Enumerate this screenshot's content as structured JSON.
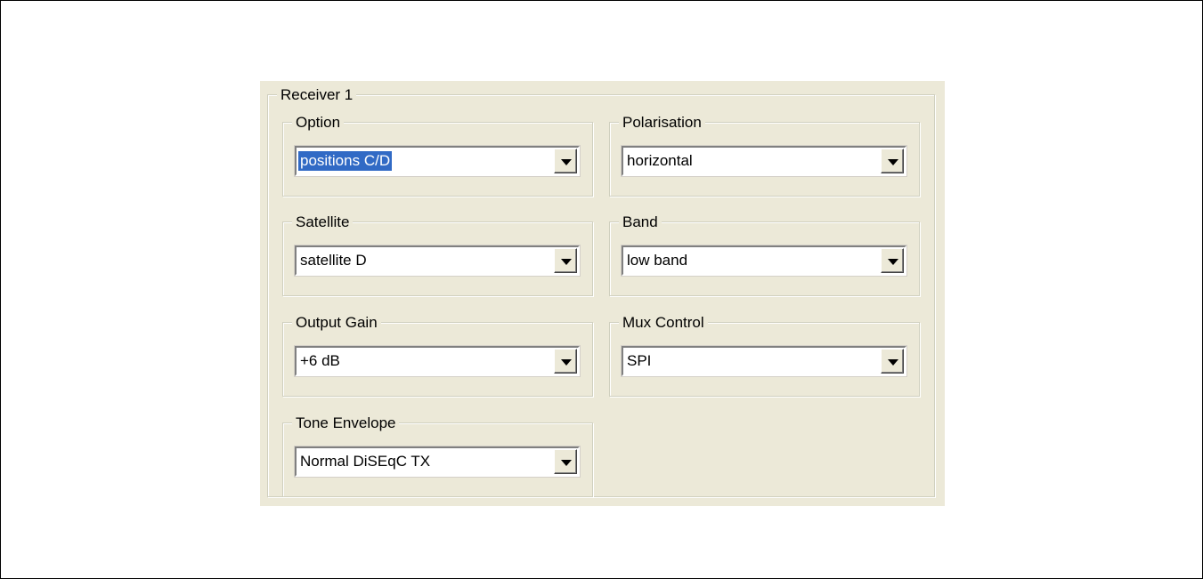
{
  "receiver": {
    "title": "Receiver 1",
    "option": {
      "label": "Option",
      "value": "positions C/D"
    },
    "polarisation": {
      "label": "Polarisation",
      "value": "horizontal"
    },
    "satellite": {
      "label": "Satellite",
      "value": "satellite D"
    },
    "band": {
      "label": "Band",
      "value": "low band"
    },
    "output_gain": {
      "label": "Output Gain",
      "value": "+6 dB"
    },
    "mux_control": {
      "label": "Mux Control",
      "value": "SPI"
    },
    "tone_envelope": {
      "label": "Tone Envelope",
      "value": "Normal DiSEqC TX"
    }
  },
  "icons": {
    "dropdown": "chevron-down-icon"
  },
  "colors": {
    "panel_bg": "#ece9d8",
    "selection": "#316ac5"
  }
}
